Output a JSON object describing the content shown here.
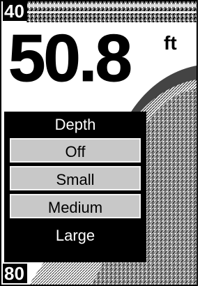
{
  "range": {
    "top": "40",
    "bottom": "80"
  },
  "depth": {
    "value": "50.8",
    "unit": "ft"
  },
  "menu": {
    "title": "Depth",
    "items": [
      {
        "label": "Off"
      },
      {
        "label": "Small"
      },
      {
        "label": "Medium"
      },
      {
        "label": "Large"
      }
    ],
    "selected": "Large"
  }
}
